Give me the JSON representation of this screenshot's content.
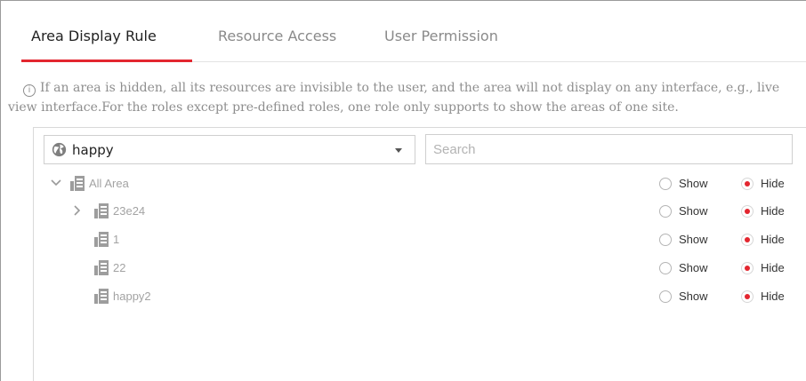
{
  "tabs": [
    {
      "label": "Area Display Rule",
      "active": true
    },
    {
      "label": "Resource Access",
      "active": false
    },
    {
      "label": "User Permission",
      "active": false
    }
  ],
  "info": {
    "icon": "info-icon",
    "text": "If an area is hidden, all its resources are invisible to the user, and the area will not display on any interface, e.g., live view interface.For the roles except pre-defined roles, one role only supports to show the areas of one site."
  },
  "site_select": {
    "value": "happy",
    "icon": "globe-icon"
  },
  "search": {
    "placeholder": "Search",
    "value": ""
  },
  "tree": [
    {
      "label": "All Area",
      "expand": "expanded",
      "level": 0,
      "visibility": "Hide"
    },
    {
      "label": "23e24",
      "expand": "collapsed",
      "level": 1,
      "visibility": "Hide"
    },
    {
      "label": "1",
      "expand": "none",
      "level": 1,
      "visibility": "Hide"
    },
    {
      "label": "22",
      "expand": "none",
      "level": 1,
      "visibility": "Hide"
    },
    {
      "label": "happy2",
      "expand": "none",
      "level": 1,
      "visibility": "Hide"
    }
  ],
  "options": {
    "show": "Show",
    "hide": "Hide"
  },
  "colors": {
    "accent": "#e3262f",
    "muted_text": "#8e8e8e",
    "border": "#cfcfcf"
  }
}
